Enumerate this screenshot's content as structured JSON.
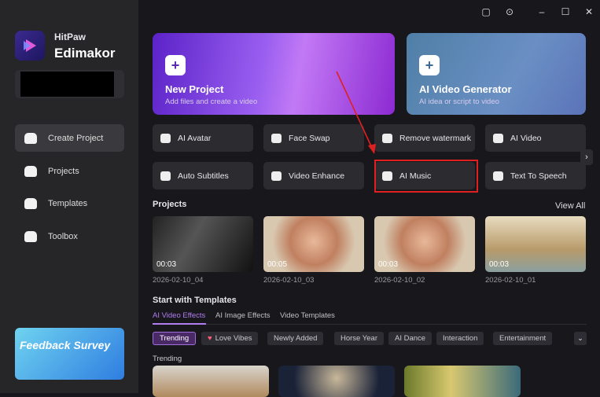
{
  "brand": {
    "line1": "HitPaw",
    "line2": "Edimakor"
  },
  "sidebar": {
    "items": [
      {
        "label": "Create Project",
        "active": true
      },
      {
        "label": "Projects"
      },
      {
        "label": "Templates"
      },
      {
        "label": "Toolbox"
      }
    ],
    "feedback": "Feedback Survey"
  },
  "titlebar": {
    "icons": [
      "chat-icon",
      "info-icon",
      "minimize-icon",
      "maximize-icon",
      "close-icon"
    ]
  },
  "hero": [
    {
      "title": "New Project",
      "subtitle": "Add files and create a video"
    },
    {
      "title": "AI Video Generator",
      "subtitle": "AI idea or script to video"
    }
  ],
  "tools": [
    {
      "label": "AI Avatar",
      "icon": "avatar"
    },
    {
      "label": "Face Swap",
      "icon": "face"
    },
    {
      "label": "Remove watermark",
      "icon": "eraser"
    },
    {
      "label": "AI Video",
      "icon": "video"
    },
    {
      "label": "Auto Subtitles",
      "icon": "CC"
    },
    {
      "label": "Video Enhance",
      "icon": "enhance"
    },
    {
      "label": "AI Music",
      "icon": "music",
      "highlighted": true
    },
    {
      "label": "Text To Speech",
      "icon": "speech"
    }
  ],
  "projects": {
    "title": "Projects",
    "view_all": "View All",
    "items": [
      {
        "duration": "00:03",
        "date": "2026-02-10_04"
      },
      {
        "duration": "00:05",
        "date": "2026-02-10_03"
      },
      {
        "duration": "00:03",
        "date": "2026-02-10_02"
      },
      {
        "duration": "00:03",
        "date": "2026-02-10_01"
      }
    ]
  },
  "templates": {
    "title": "Start with Templates",
    "tabs": [
      "AI Video Effects",
      "AI Image Effects",
      "Video Templates"
    ],
    "chips": [
      "Trending",
      "Love Vibes",
      "Newly Added",
      "Horse Year",
      "AI Dance",
      "Interaction",
      "Entertainment"
    ],
    "section": "Trending"
  },
  "colors": {
    "accent": "#9b5de5",
    "highlight": "#e02020"
  }
}
